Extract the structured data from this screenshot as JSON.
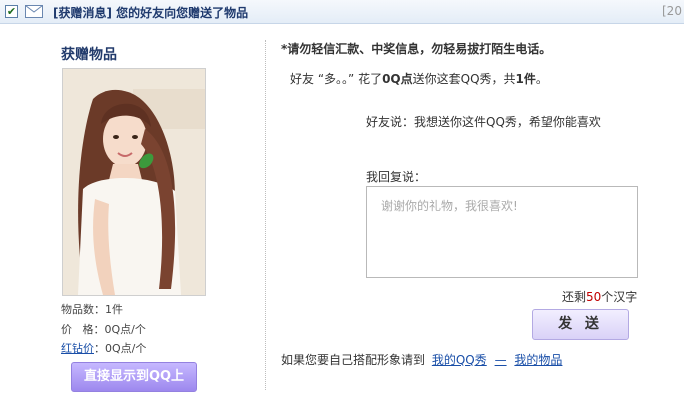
{
  "header": {
    "checked": "✔",
    "title": "[获赠消息] 您的好友向您赠送了物品",
    "date": "[20"
  },
  "left": {
    "gift_title": "获赠物品",
    "count_label": "物品数：",
    "count_value": "1件",
    "price_label": "价   格：",
    "price_value": "0Q点/个",
    "red_diamond_label": "红钻价",
    "red_diamond_value": "：0Q点/个",
    "show_button": "直接显示到QQ上"
  },
  "right": {
    "warning": "*请勿轻信汇款、中奖信息，勿轻易拔打陌生电话。",
    "summary_prefix": "好友 “多。。” 花了",
    "summary_points": "0Q点",
    "summary_middle": "送你这套QQ秀，共",
    "summary_count": "1件",
    "summary_suffix": "。",
    "friend_says": "好友说：我想送你这件QQ秀，希望你能喜欢",
    "reply_label": "我回复说：",
    "reply_placeholder": "谢谢你的礼物，我很喜欢!",
    "remaining_prefix": "还剩",
    "remaining_count": "50",
    "remaining_suffix": "个汉字",
    "send_button": "发 送",
    "footer_text": "如果您要自己搭配形象请到",
    "footer_link_qqshow": "我的QQ秀",
    "footer_separator": "—",
    "footer_link_items": "我的物品"
  },
  "colors": {
    "accent_purple": "#9d88ee",
    "link_blue": "#1a4fa8",
    "count_red": "#c00000"
  }
}
